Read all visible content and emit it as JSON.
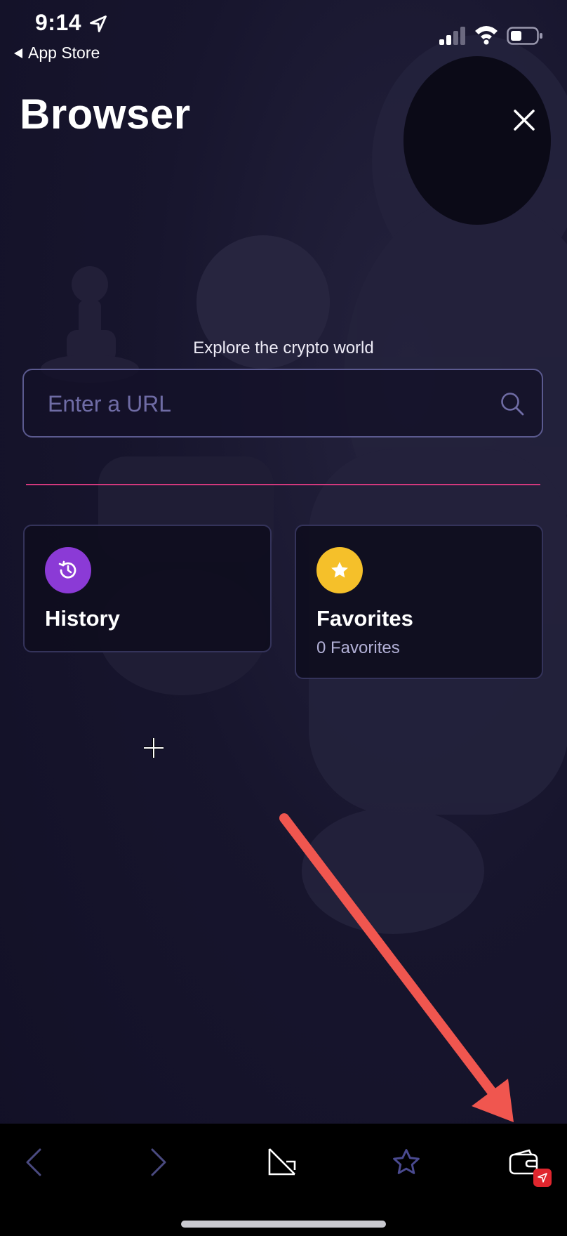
{
  "status_bar": {
    "time": "9:14",
    "back_app_label": "App Store",
    "icons": [
      "location-arrow-icon",
      "cellular-signal-icon",
      "wifi-icon",
      "battery-icon"
    ]
  },
  "header": {
    "title": "Browser",
    "close_icon": "close-icon"
  },
  "search": {
    "tagline": "Explore the crypto world",
    "placeholder": "Enter a URL",
    "value": "",
    "icon": "search-icon"
  },
  "cards": {
    "history": {
      "label": "History",
      "icon": "history-clock-icon",
      "icon_color": "#8b3ad6"
    },
    "favorites": {
      "label": "Favorites",
      "count_label": "0 Favorites",
      "icon": "star-icon",
      "icon_color": "#f5c02a"
    }
  },
  "bottom_nav": {
    "items": [
      {
        "name": "back",
        "icon": "chevron-left-icon"
      },
      {
        "name": "forward",
        "icon": "chevron-right-icon"
      },
      {
        "name": "tabs",
        "icon": "tabs-icon"
      },
      {
        "name": "favorites",
        "icon": "star-outline-icon"
      },
      {
        "name": "wallet",
        "icon": "wallet-icon",
        "badge_icon": "send-icon"
      }
    ]
  },
  "colors": {
    "background": "#15132a",
    "accent_divider": "#d2387d",
    "input_border": "#5b5a8f",
    "annotation_arrow": "#f0564f",
    "wallet_badge": "#e0262e"
  }
}
